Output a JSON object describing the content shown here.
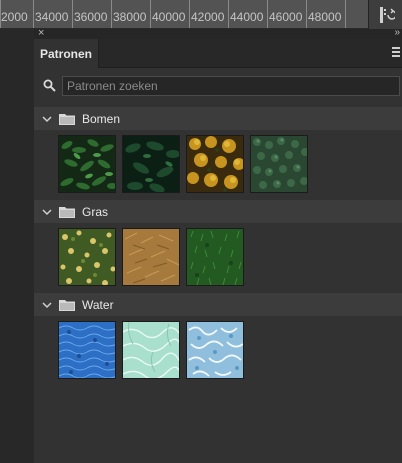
{
  "ruler": {
    "labels": [
      "2000",
      "34000",
      "36000",
      "38000",
      "40000",
      "42000",
      "44000",
      "46000",
      "48000"
    ]
  },
  "panel": {
    "title": "Patronen",
    "close_glyph": "×",
    "collapse_glyph": "»",
    "search": {
      "placeholder": "Patronen zoeken",
      "value": ""
    },
    "groups": [
      {
        "label": "Bomen",
        "patterns": [
          "trees-dark-leaves",
          "trees-dark-green",
          "trees-autumn-yellow",
          "trees-pine-aerial"
        ]
      },
      {
        "label": "Gras",
        "patterns": [
          "grass-with-flowers",
          "grass-dry-brown",
          "grass-green"
        ]
      },
      {
        "label": "Water",
        "patterns": [
          "water-blue-ripples",
          "water-pool-light",
          "water-white-ripples"
        ]
      }
    ]
  },
  "colors": {
    "panel_bg": "#323232",
    "group_header_bg": "#3c3c3c",
    "tab_active_bg": "#323232"
  },
  "icons": {
    "search": "search-icon",
    "folder": "folder-icon",
    "chevron": "chevron-down-icon",
    "panel_menu": "hamburger-icon",
    "history": "history-icon"
  }
}
